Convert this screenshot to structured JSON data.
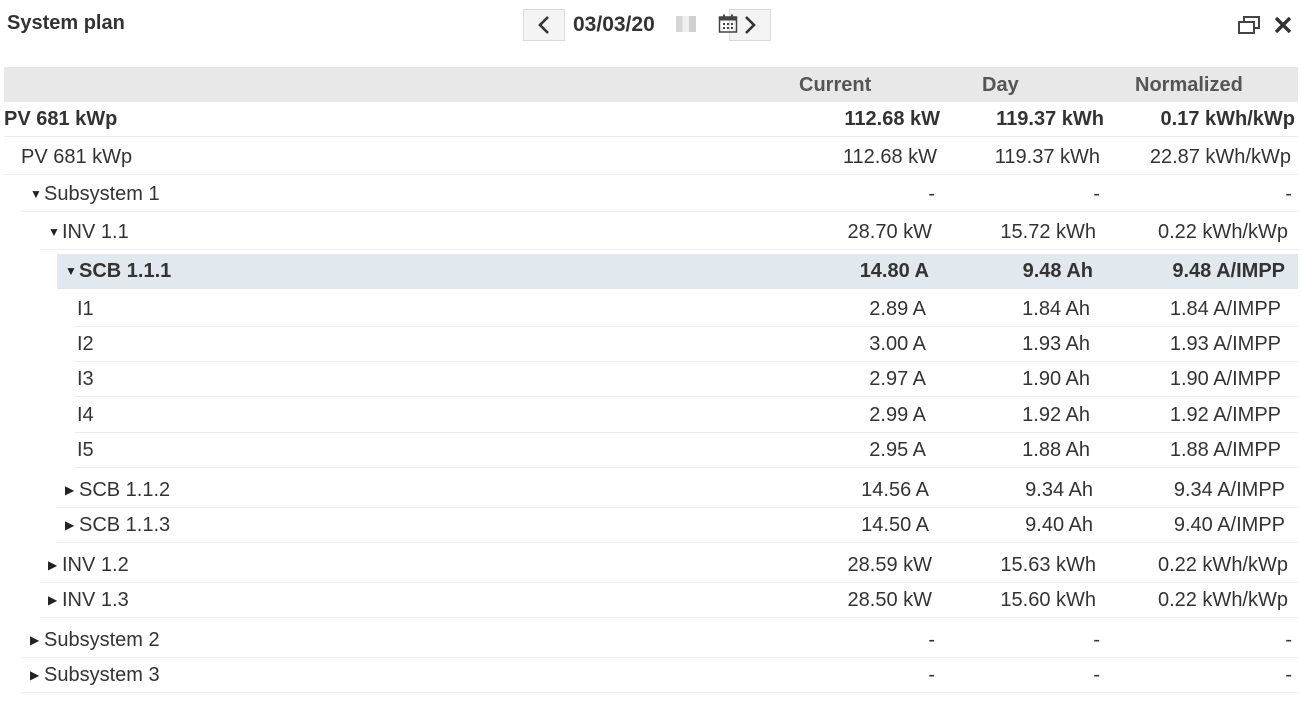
{
  "title": "System plan",
  "date": {
    "value": "03/03/20",
    "prev_icon": "chevron-left-icon",
    "next_icon": "chevron-right-icon",
    "calendar_icon": "calendar-icon"
  },
  "window": {
    "restore_icon": "restore-window-icon",
    "close_icon": "close-icon"
  },
  "columns": {
    "current": "Current",
    "day": "Day",
    "normalized": "Normalized"
  },
  "rows": [
    {
      "name": "PV 681 kWp",
      "current": "112.68 kW",
      "day": "119.37 kWh",
      "normalized": "0.17 kWh/kWp",
      "caret": ""
    },
    {
      "name": "PV 681 kWp",
      "current": "112.68 kW",
      "day": "119.37 kWh",
      "normalized": "22.87 kWh/kWp",
      "caret": ""
    },
    {
      "name": "Subsystem 1",
      "current": "-",
      "day": "-",
      "normalized": "-",
      "caret": "▼"
    },
    {
      "name": "INV 1.1",
      "current": "28.70 kW",
      "day": "15.72 kWh",
      "normalized": "0.22 kWh/kWp",
      "caret": "▼"
    },
    {
      "name": "SCB 1.1.1",
      "current": "14.80 A",
      "day": "9.48 Ah",
      "normalized": "9.48 A/IMPP",
      "caret": "▼"
    },
    {
      "name": "I1",
      "current": "2.89 A",
      "day": "1.84 Ah",
      "normalized": "1.84 A/IMPP",
      "caret": ""
    },
    {
      "name": "I2",
      "current": "3.00 A",
      "day": "1.93 Ah",
      "normalized": "1.93 A/IMPP",
      "caret": ""
    },
    {
      "name": "I3",
      "current": "2.97 A",
      "day": "1.90 Ah",
      "normalized": "1.90 A/IMPP",
      "caret": ""
    },
    {
      "name": "I4",
      "current": "2.99 A",
      "day": "1.92 Ah",
      "normalized": "1.92 A/IMPP",
      "caret": ""
    },
    {
      "name": "I5",
      "current": "2.95 A",
      "day": "1.88 Ah",
      "normalized": "1.88 A/IMPP",
      "caret": ""
    },
    {
      "name": "SCB 1.1.2",
      "current": "14.56 A",
      "day": "9.34 Ah",
      "normalized": "9.34 A/IMPP",
      "caret": "▶"
    },
    {
      "name": "SCB 1.1.3",
      "current": "14.50 A",
      "day": "9.40 Ah",
      "normalized": "9.40 A/IMPP",
      "caret": "▶"
    },
    {
      "name": "INV 1.2",
      "current": "28.59 kW",
      "day": "15.63 kWh",
      "normalized": "0.22 kWh/kWp",
      "caret": "▶"
    },
    {
      "name": "INV 1.3",
      "current": "28.50 kW",
      "day": "15.60 kWh",
      "normalized": "0.22 kWh/kWp",
      "caret": "▶"
    },
    {
      "name": "Subsystem 2",
      "current": "-",
      "day": "-",
      "normalized": "-",
      "caret": "▶"
    },
    {
      "name": "Subsystem 3",
      "current": "-",
      "day": "-",
      "normalized": "-",
      "caret": "▶"
    }
  ]
}
